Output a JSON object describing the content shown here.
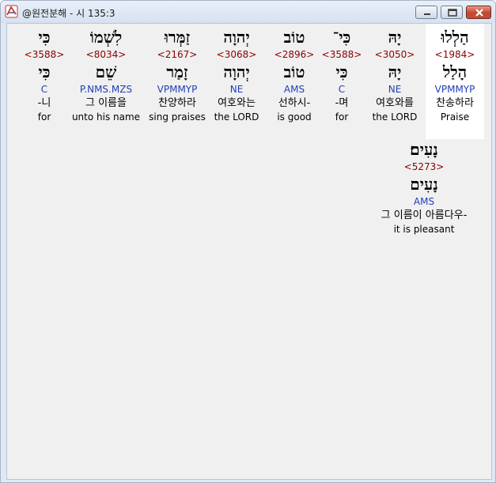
{
  "window": {
    "title": "@원전분해 - 시 135:3"
  },
  "words": [
    {
      "hebrew": "הַלְלוּ",
      "strong": "<1984>",
      "lemma": "הָלַל",
      "morph": "VPMMYP",
      "korean": "찬송하라",
      "english": "Praise",
      "selected": true
    },
    {
      "hebrew": "יָהּ",
      "strong": "<3050>",
      "lemma": "יָהּ",
      "morph": "NE",
      "korean": "여호와를",
      "english": "the LORD",
      "selected": false
    },
    {
      "hebrew": "כִּי־",
      "strong": "<3588>",
      "lemma": "כִּי",
      "morph": "C",
      "korean": "-며",
      "english": "for",
      "selected": false
    },
    {
      "hebrew": "טוֹב",
      "strong": "<2896>",
      "lemma": "טוֹב",
      "morph": "AMS",
      "korean": "선하시-",
      "english": "is good",
      "selected": false
    },
    {
      "hebrew": "יְהוָה",
      "strong": "<3068>",
      "lemma": "יְהוָה",
      "morph": "NE",
      "korean": "여호와는",
      "english": "the LORD",
      "selected": false
    },
    {
      "hebrew": "זַמְּרוּ",
      "strong": "<2167>",
      "lemma": "זָמַר",
      "morph": "VPMMYP",
      "korean": "찬양하라",
      "english": "sing praises",
      "selected": false
    },
    {
      "hebrew": "לִשְׁמוֹ",
      "strong": "<8034>",
      "lemma": "שֵׁם",
      "morph": "P.NMS.MZS",
      "korean": "그 이름을",
      "english": "unto his name",
      "selected": false
    },
    {
      "hebrew": "כִּי",
      "strong": "<3588>",
      "lemma": "כִּי",
      "morph": "C",
      "korean": "-니",
      "english": "for",
      "selected": false
    },
    {
      "hebrew": "נָעִים׃",
      "strong": "<5273>",
      "lemma": "נָעִים",
      "morph": "AMS",
      "korean": "그 이름이 아름다우-",
      "english": "it is pleasant",
      "selected": false
    }
  ]
}
